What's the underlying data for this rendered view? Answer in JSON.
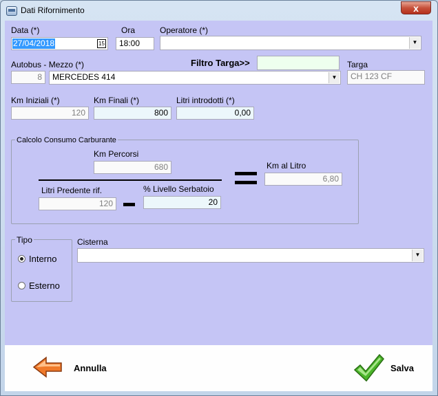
{
  "window": {
    "title": "Dati Rifornimento",
    "close_glyph": "x"
  },
  "header": {
    "data_label": "Data (*)",
    "data_value": "27/04/2018",
    "calendar_glyph": "15",
    "ora_label": "Ora",
    "ora_value": "18:00",
    "operatore_label": "Operatore (*)",
    "operatore_value": ""
  },
  "vehicle": {
    "autobus_label": "Autobus - Mezzo (*)",
    "autobus_number": "8",
    "mezzo_value": "MERCEDES 414",
    "filtro_label": "Filtro Targa>>",
    "filtro_value": "",
    "targa_label": "Targa",
    "targa_value": "CH 123 CF"
  },
  "km": {
    "iniziali_label": "Km Iniziali (*)",
    "iniziali_value": "120",
    "finali_label": "Km Finali (*)",
    "finali_value": "800",
    "litri_label": "Litri introdotti (*)",
    "litri_value": "0,00"
  },
  "consumo": {
    "group_title": "Calcolo Consumo Carburante",
    "km_percorsi_label": "Km Percorsi",
    "km_percorsi_value": "680",
    "litri_pred_label": "Litri Predente rif.",
    "litri_pred_value": "120",
    "livello_label": "% Livello Serbatoio",
    "livello_value": "20",
    "km_litro_label": "Km al Litro",
    "km_litro_value": "6,80"
  },
  "tipo": {
    "group_title": "Tipo",
    "interno_label": "Interno",
    "esterno_label": "Esterno",
    "selected": "Interno"
  },
  "cisterna": {
    "label": "Cisterna",
    "value": ""
  },
  "footer": {
    "annulla_label": "Annulla",
    "salva_label": "Salva"
  },
  "colors": {
    "client_bg": "#c5c5f5",
    "annulla_arrow": "#f07a2a",
    "salva_check": "#4bb52a"
  },
  "icons": {
    "dropdown": "chevron-down-icon",
    "back": "arrow-left-icon",
    "confirm": "checkmark-icon",
    "calendar": "calendar-icon"
  }
}
